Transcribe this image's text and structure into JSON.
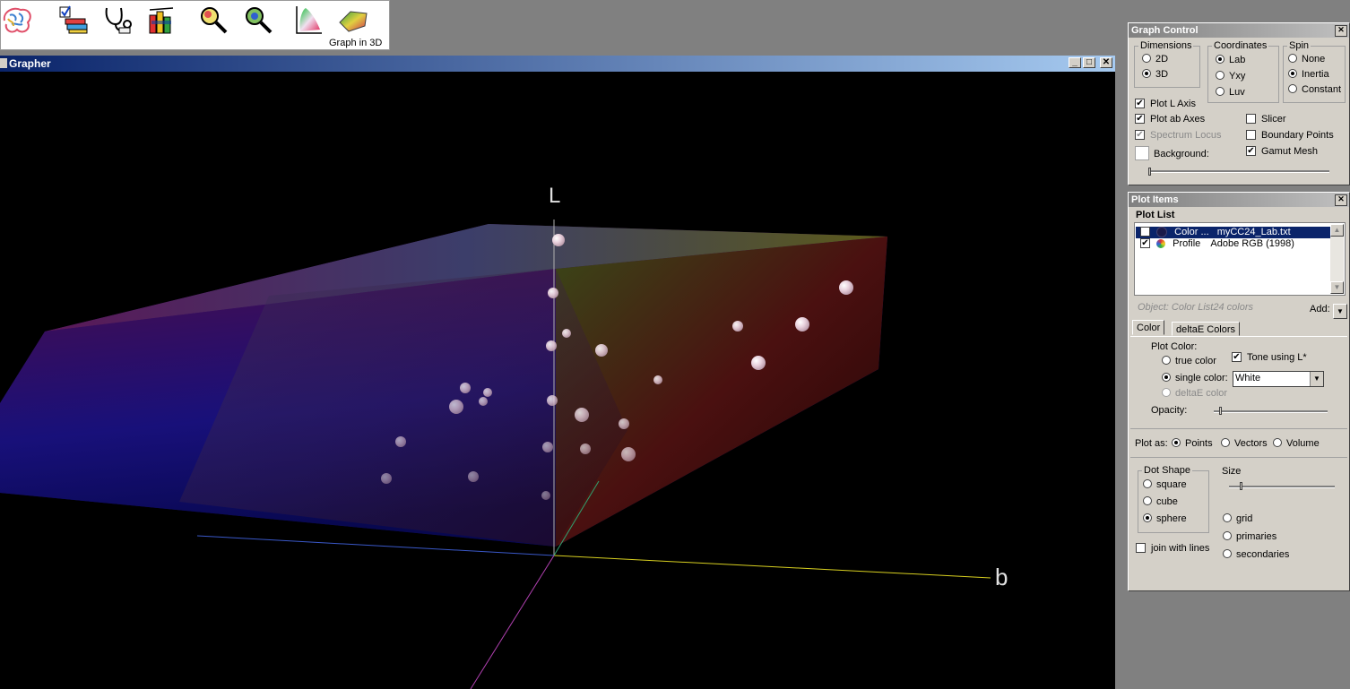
{
  "toolbar": {
    "graph3d_caption": "Graph in 3D"
  },
  "grapher": {
    "title": "Grapher",
    "axis_l": "L",
    "axis_b": "b"
  },
  "graph_control": {
    "title": "Graph Control",
    "dimensions": {
      "legend": "Dimensions",
      "options": [
        "2D",
        "3D"
      ],
      "selected": "3D"
    },
    "coordinates": {
      "legend": "Coordinates",
      "options": [
        "Lab",
        "Yxy",
        "Luv"
      ],
      "selected": "Lab"
    },
    "spin": {
      "legend": "Spin",
      "options": [
        "None",
        "Inertia",
        "Constant"
      ],
      "selected": "Inertia"
    },
    "checks": {
      "plot_l_axis": {
        "label": "Plot L Axis",
        "checked": true
      },
      "plot_ab_axes": {
        "label": "Plot ab Axes",
        "checked": true
      },
      "spectrum_locus": {
        "label": "Spectrum Locus",
        "checked": true,
        "disabled": true
      },
      "slicer": {
        "label": "Slicer",
        "checked": false
      },
      "boundary_points": {
        "label": "Boundary Points",
        "checked": false
      },
      "gamut_mesh": {
        "label": "Gamut Mesh",
        "checked": true
      }
    },
    "background_label": "Background:"
  },
  "plot_items": {
    "title": "Plot Items",
    "list_label": "Plot List",
    "rows": [
      {
        "type": "Color ...",
        "name": "myCC24_Lab.txt",
        "checked": true,
        "selected": true
      },
      {
        "type": "Profile",
        "name": "Adobe RGB (1998)",
        "checked": true,
        "selected": false
      }
    ],
    "object_info": "Object: Color List24 colors",
    "add_label": "Add:",
    "tabs": [
      "Color",
      "deltaE Colors"
    ],
    "active_tab": "Color",
    "plot_color_label": "Plot Color:",
    "plot_color_options": [
      "true color",
      "single color:",
      "deltaE color"
    ],
    "plot_color_selected": "single color:",
    "tone_label": "Tone using L*",
    "tone_checked": true,
    "single_color_value": "White",
    "opacity_label": "Opacity:",
    "plot_as_label": "Plot as:",
    "plot_as_options": [
      "Points",
      "Vectors",
      "Volume"
    ],
    "plot_as_selected": "Points",
    "dot_shape": {
      "legend": "Dot Shape",
      "options": [
        "square",
        "cube",
        "sphere"
      ],
      "selected": "sphere"
    },
    "size_label": "Size",
    "extras": [
      "grid",
      "primaries",
      "secondaries"
    ],
    "join_label": "join with lines",
    "join_checked": false
  },
  "colors": {
    "title_bar_active": "#0a246a",
    "panel_bg": "#d4d0c8",
    "viewport_bg": "#000000"
  }
}
